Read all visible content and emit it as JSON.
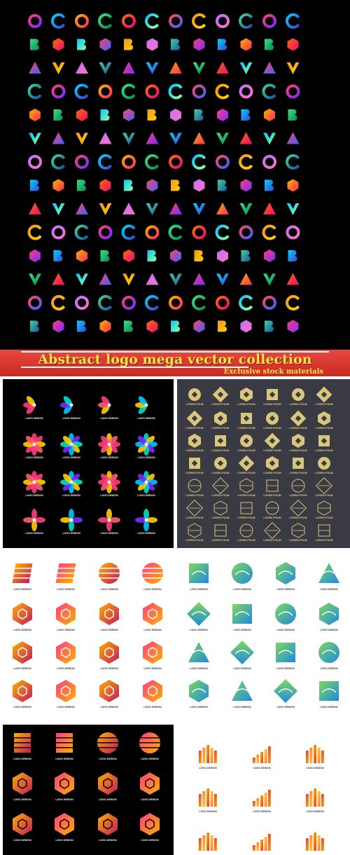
{
  "banner": {
    "title": "Abstract logo mega vector collection",
    "subtitle": "Exclusive stock materials"
  },
  "caption_text": "LOGO DESIGN",
  "caption_text_gold": "LOREM IPSUM",
  "colors": {
    "top_bg": "#000000",
    "banner_red": "#e0413a",
    "banner_text": "#ffe64a",
    "gold_panel_bg": "#3a3a44",
    "gold": "#d8c77a"
  },
  "icons": {
    "top": [
      "letter-b-icon",
      "letter-c-icon",
      "letter-m-icon",
      "letter-a-icon",
      "letter-s-icon",
      "letter-r-icon",
      "hexagon-icon",
      "triangle-icon",
      "swirl-icon",
      "chevron-icon"
    ],
    "flowers": "flower-petal-icon",
    "gold": "geometric-line-icon",
    "orange": "hexagon-stripe-icon",
    "green": "geometric-tile-icon",
    "stripes": "stripe-shape-icon"
  }
}
